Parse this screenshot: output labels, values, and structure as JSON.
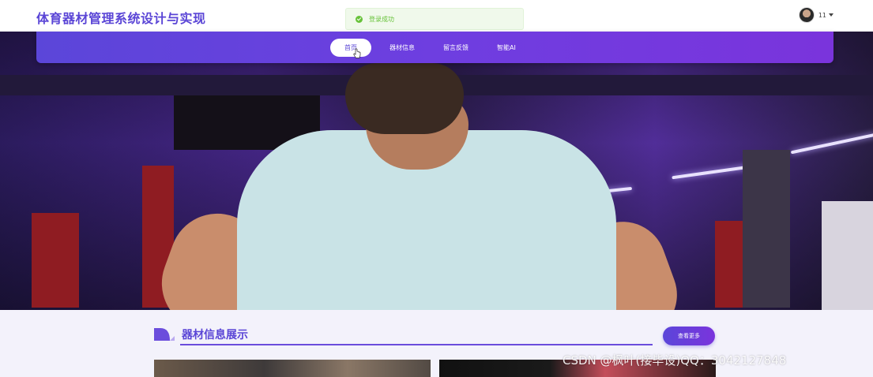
{
  "header": {
    "site_title": "体育器材管理系统设计与实现",
    "toast_message": "登录成功",
    "username": "11"
  },
  "nav": {
    "items": [
      {
        "label": "首页",
        "active": true
      },
      {
        "label": "器材信息",
        "active": false
      },
      {
        "label": "留言反馈",
        "active": false
      },
      {
        "label": "智能AI",
        "active": false
      }
    ]
  },
  "hero": {
    "slide_count": 3,
    "active_slide": 1
  },
  "section": {
    "title": "器材信息展示",
    "more_label": "查看更多"
  },
  "watermark": "CSDN @枫叶(接毕设)QQ：3042127848",
  "colors": {
    "brand": "#5a45d6",
    "nav_gradient_start": "#5b46d9",
    "nav_gradient_end": "#7a34dc",
    "toast_success": "#67c23a"
  }
}
